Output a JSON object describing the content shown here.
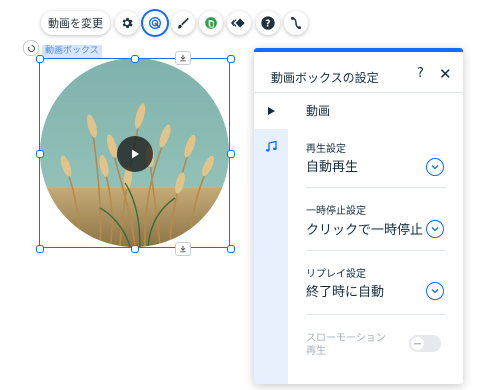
{
  "toolbar": {
    "change_video_label": "動画を変更",
    "icons": [
      "gear-icon",
      "touch-icon",
      "brush-icon",
      "layers-icon",
      "animation-icon",
      "help-icon",
      "connect-icon"
    ]
  },
  "element_label": "動画ボックス",
  "panel": {
    "title": "動画ボックスの設定",
    "help": "?",
    "close": "✕",
    "tab_title": "動画",
    "sections": {
      "playback": {
        "label": "再生設定",
        "value": "自動再生"
      },
      "pause": {
        "label": "一時停止設定",
        "value": "クリックで一時停止"
      },
      "replay": {
        "label": "リプレイ設定",
        "value": "終了時に自動"
      },
      "slow_motion": {
        "label_line1": "スローモーション",
        "label_line2": "再生",
        "enabled": false
      }
    }
  },
  "colors": {
    "accent": "#116dff",
    "panel_sidebar": "#e7f0ff"
  }
}
